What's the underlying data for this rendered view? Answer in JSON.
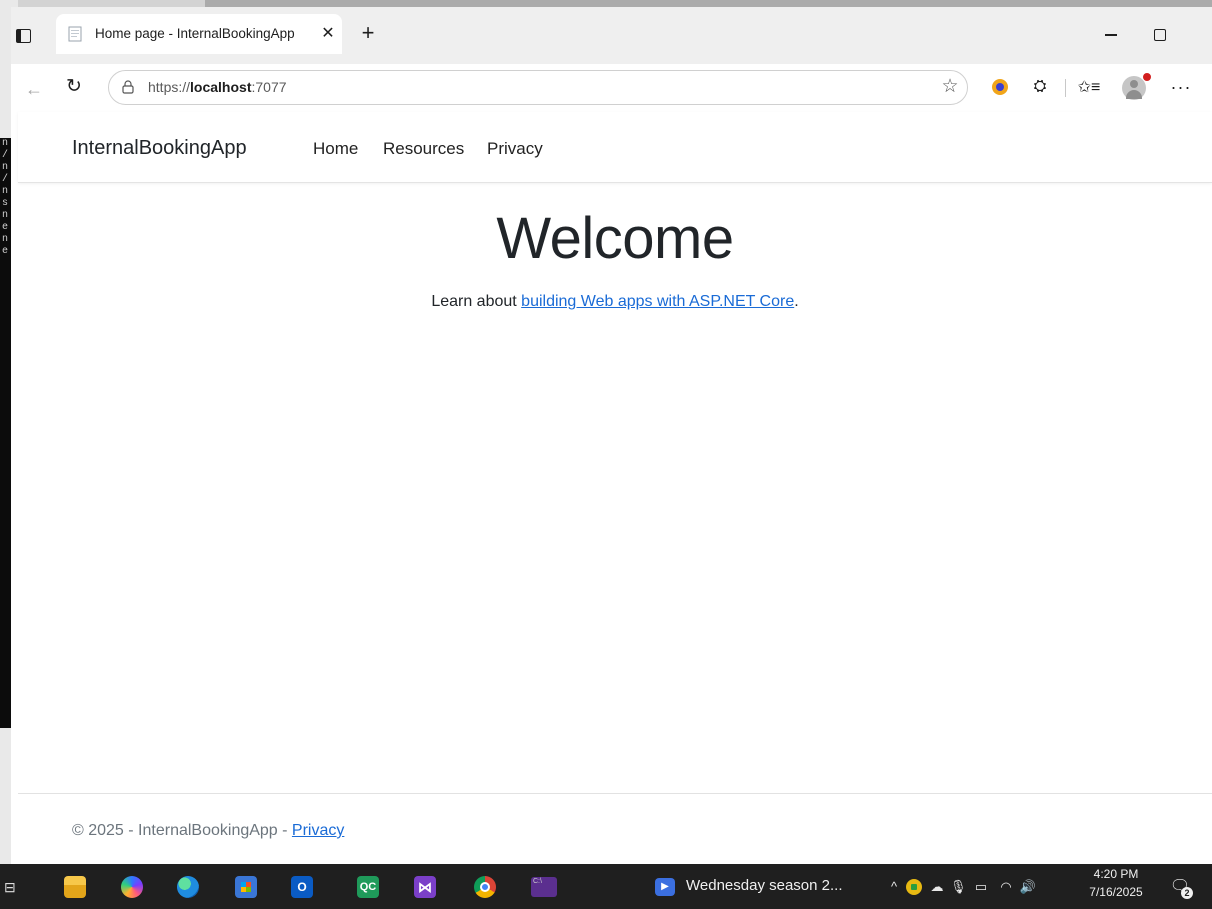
{
  "background": {
    "terminal_chars": [
      "n",
      "/",
      "n",
      "/",
      "n",
      "s",
      "n",
      "e",
      "n",
      "e"
    ]
  },
  "browser": {
    "tab": {
      "title": "Home page - InternalBookingApp",
      "close_glyph": "✕"
    },
    "new_tab_glyph": "+",
    "nav": {
      "back_glyph": "←",
      "refresh_glyph": "↻"
    },
    "address": {
      "scheme": "https://",
      "host": "localhost",
      "port": ":7077"
    },
    "toolbar": {
      "favorite_glyph": "☆",
      "extensions_glyph": "⛭",
      "favorites_glyph": "✩≡",
      "more_glyph": "···"
    }
  },
  "page": {
    "brand": "InternalBookingApp",
    "nav_links": [
      "Home",
      "Resources",
      "Privacy"
    ],
    "heading": "Welcome",
    "learn_prefix": "Learn about ",
    "learn_link": "building Web apps with ASP.NET Core",
    "learn_suffix": ".",
    "footer_prefix": "© 2025 - InternalBookingApp - ",
    "footer_link": "Privacy"
  },
  "taskbar": {
    "apps": [
      {
        "name": "task-view",
        "glyph": "⊟"
      },
      {
        "name": "file-explorer"
      },
      {
        "name": "copilot"
      },
      {
        "name": "edge"
      },
      {
        "name": "microsoft-store"
      },
      {
        "name": "outlook",
        "glyph": "O"
      },
      {
        "name": "qc",
        "glyph": "QC"
      },
      {
        "name": "visual-studio",
        "glyph": "⋈"
      },
      {
        "name": "chrome"
      },
      {
        "name": "terminal",
        "glyph": "C:\\"
      }
    ],
    "media": {
      "glyph": "▶",
      "label": "Wednesday season 2..."
    },
    "tray": {
      "chevron": "^",
      "onedrive": "☁",
      "mic": "🎙",
      "battery": "▭",
      "wifi": "◠",
      "volume": "🔊"
    },
    "clock": {
      "time": "4:20 PM",
      "date": "7/16/2025"
    },
    "notifications": {
      "glyph": "🗨",
      "count": "2"
    }
  }
}
